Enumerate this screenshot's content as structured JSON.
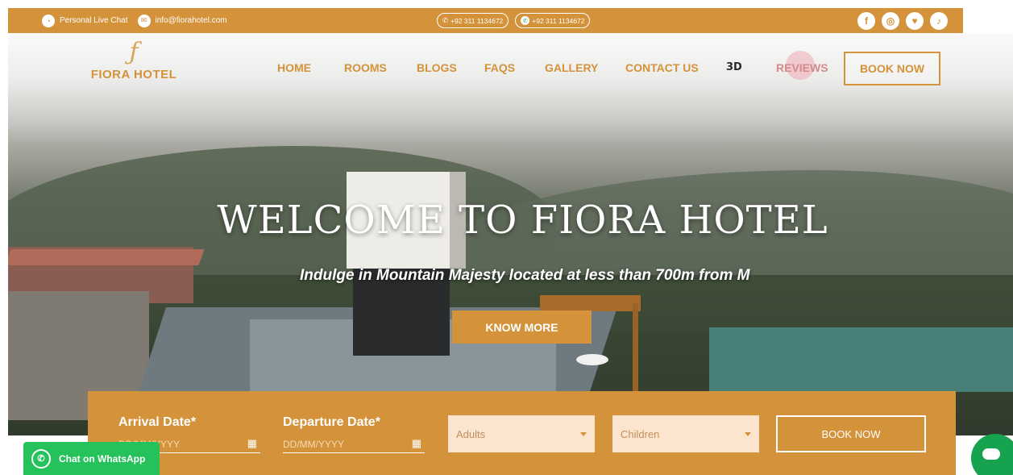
{
  "topbar": {
    "live_chat": "Personal Live Chat",
    "email": "info@fiorahotel.com",
    "phone": "+92 311 1134672",
    "whatsapp": "+92 311 1134672",
    "social": [
      {
        "icon": "facebook-icon",
        "glyph": "f"
      },
      {
        "icon": "instagram-icon",
        "glyph": "◎"
      },
      {
        "icon": "twitter-icon",
        "glyph": "♥"
      },
      {
        "icon": "tiktok-icon",
        "glyph": "♪"
      }
    ]
  },
  "logo": {
    "mark": "ƒ",
    "name": "FIORA HOTEL"
  },
  "nav": {
    "home": "HOME",
    "rooms": "ROOMS",
    "blogs": "BLOGS",
    "faqs": "FAQS",
    "gallery": "GALLERY",
    "contact": "CONTACT US",
    "three_d": "3D",
    "reviews": "REVIEWS",
    "book_now": "BOOK NOW"
  },
  "hero": {
    "headline": "WELCOME TO FIORA HOTEL",
    "subline": "Indulge in Mountain Majesty located at less than 700m from M",
    "cta": "KNOW MORE"
  },
  "booking": {
    "arrival_label": "Arrival Date*",
    "arrival_placeholder": "DD/MM/YYYY",
    "departure_label": "Departure Date*",
    "departure_placeholder": "DD/MM/YYYY",
    "adults": "Adults",
    "children": "Children",
    "submit": "BOOK NOW"
  },
  "whatsapp_chat": {
    "label": "Chat on WhatsApp"
  },
  "colors": {
    "brand": "#d4923a",
    "whatsapp": "#25c15a"
  }
}
